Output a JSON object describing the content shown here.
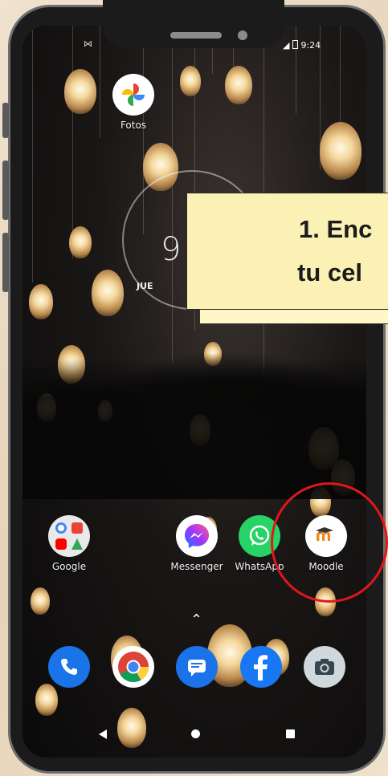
{
  "status_bar": {
    "time": "9:24"
  },
  "home_screen": {
    "apps": [
      {
        "label": "Fotos"
      },
      {
        "label": "Google"
      },
      {
        "label": "Messenger"
      },
      {
        "label": "WhatsApp"
      },
      {
        "label": "Moodle"
      }
    ]
  },
  "clock_widget": {
    "time": "9",
    "date": "JUE"
  },
  "callout": {
    "line1": "1.  Enc",
    "line2": "tu cel"
  },
  "dock": {
    "apps": [
      "phone-icon",
      "chrome-icon",
      "messages-icon",
      "facebook-icon",
      "camera-icon"
    ]
  },
  "colors": {
    "callout_bg": "#fbf1b4",
    "highlight_red": "#e0161b",
    "moodle_orange": "#f18a1c"
  }
}
